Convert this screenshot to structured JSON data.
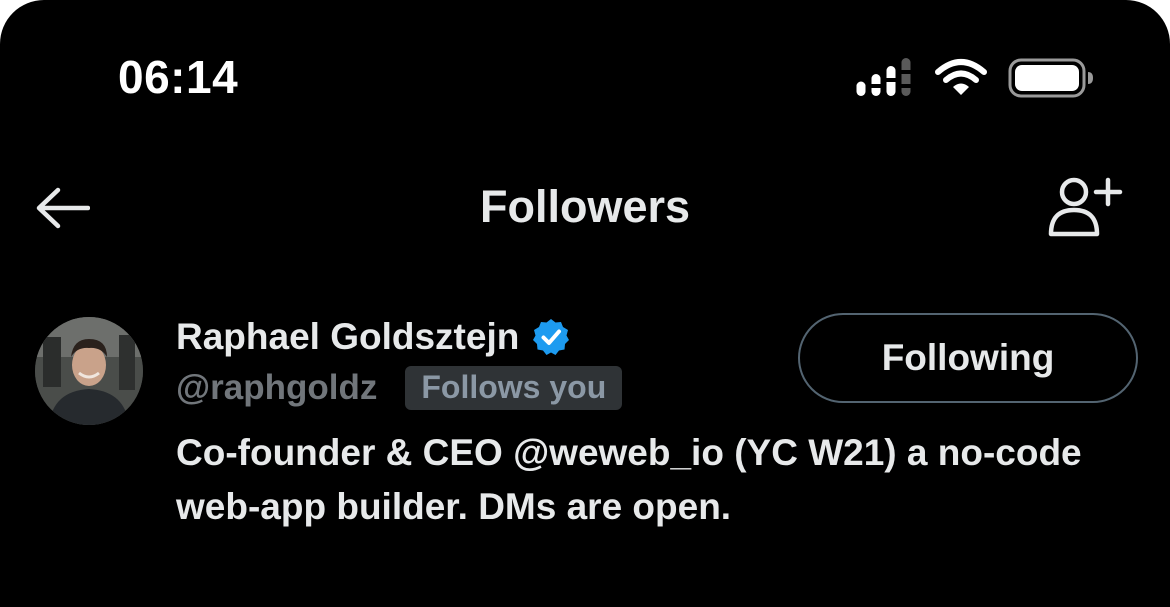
{
  "status_bar": {
    "time": "06:14",
    "signal_icon": "cellular-signal-icon",
    "wifi_icon": "wifi-icon",
    "battery_icon": "battery-icon"
  },
  "header": {
    "back_icon": "arrow-left-icon",
    "title": "Followers",
    "add_icon": "person-plus-icon"
  },
  "follower": {
    "name": "Raphael Goldsztejn",
    "verified_icon": "verified-badge-icon",
    "verified_color": "#1d9bf0",
    "handle": "@raphgoldz",
    "badge": "Follows you",
    "bio": "Co-founder & CEO @weweb_io (YC W21) a no-code web-app builder. DMs are open.",
    "button_label": "Following"
  }
}
